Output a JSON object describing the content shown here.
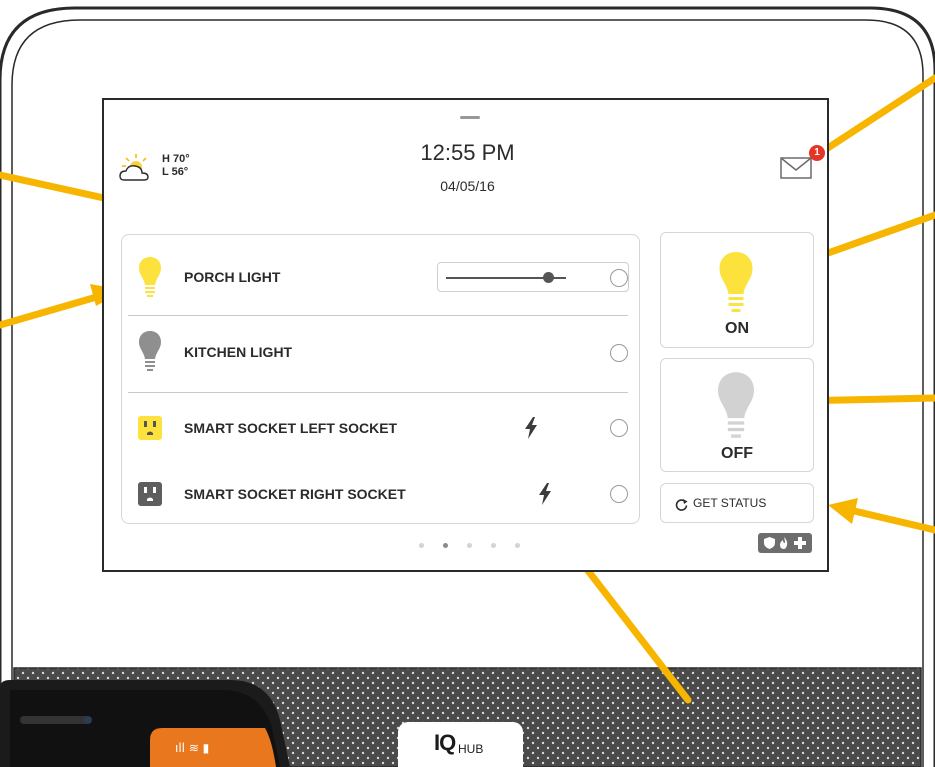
{
  "header": {
    "time": "12:55 PM",
    "date": "04/05/16",
    "weather": {
      "high": "H 70°",
      "low": "L 56°",
      "icon": "partly-cloudy-icon"
    },
    "mail": {
      "icon": "envelope-icon",
      "unread_count": "1"
    }
  },
  "devices": [
    {
      "label": "PORCH LIGHT",
      "icon": "bulb-on-icon",
      "has_dimmer": true,
      "dimmer_level": 0.85
    },
    {
      "label": "KITCHEN LIGHT",
      "icon": "bulb-off-icon"
    },
    {
      "label": "SMART SOCKET LEFT SOCKET",
      "icon": "socket-on-icon",
      "power_icon": "lightning-icon"
    },
    {
      "label": "SMART SOCKET RIGHT SOCKET",
      "icon": "socket-off-icon",
      "power_icon": "lightning-icon"
    }
  ],
  "actions": {
    "on_label": "ON",
    "off_label": "OFF",
    "status_label": "GET STATUS"
  },
  "pager": {
    "pages": 5,
    "current": 2
  },
  "status_icons": [
    "shield-icon",
    "flame-icon",
    "plus-icon"
  ],
  "hub_logo": {
    "mark": "IQ",
    "text": "HUB"
  },
  "colors": {
    "callout": "#f7b500",
    "bulb_on": "#fde23e",
    "bulb_off": "#8f8f8f",
    "badge": "#e53527",
    "phone_accent": "#e8771e"
  }
}
